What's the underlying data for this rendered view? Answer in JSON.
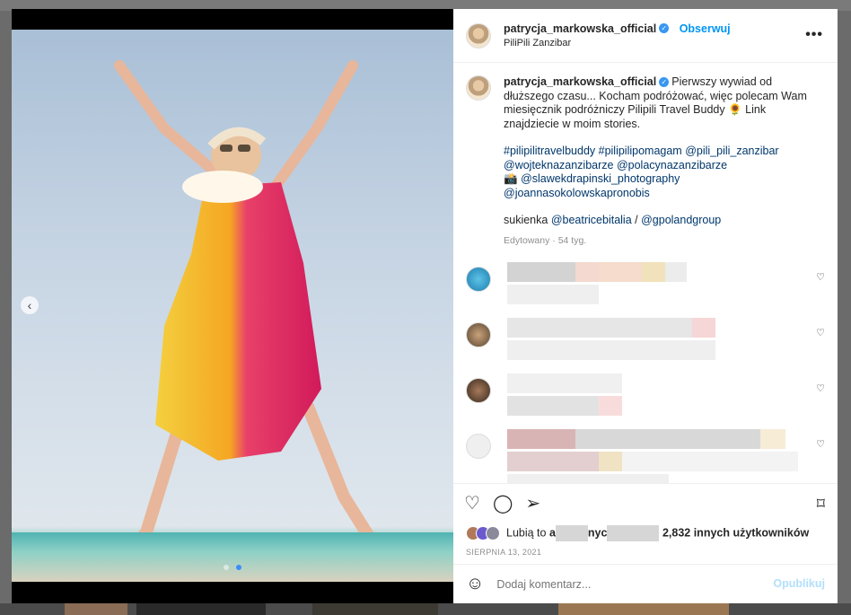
{
  "post": {
    "username": "patrycja_markowska_official",
    "verified_mark": "✓",
    "follow_label": "Obserwuj",
    "location": "PiliPili Zanzibar",
    "more_label": "•••"
  },
  "caption": {
    "text": "Pierwszy wywiad od dłuższego czasu... Kocham podróżować, więc polecam Wam miesięcznik podróżniczy Pilipili Travel Buddy 🌻 Link znajdziecie w moim stories.",
    "tags_line1": "#pilipilitravelbuddy #pilipilipomagam @pili_pili_zanzibar",
    "tags_line2": "@wojteknazanzibarze @polacynazanzibarze",
    "photo_credit_icon": "📸",
    "tags_line3": "@slawekdrapinski_photography",
    "tags_line4": "@joannasokolowskapronobis",
    "dress_label": "sukienka",
    "dress_tag1": "@beatricebitalia",
    "dress_sep": "/",
    "dress_tag2": "@gpolandgroup",
    "edited": "Edytowany · 54 tyg."
  },
  "icons": {
    "heart": "heart-icon",
    "comment": "comment-icon",
    "share": "share-icon",
    "bookmark": "bookmark-icon",
    "emoji": "emoji-icon",
    "prev": "chevron-left-icon",
    "more": "more-options-icon"
  },
  "glyphs": {
    "heart": "♡",
    "comment": "◯",
    "share": "➢",
    "bookmark": "⌑",
    "emoji": "☺",
    "prev": "‹"
  },
  "likes": {
    "prefix": "Lubią to",
    "initial": "a",
    "middle": "nyc",
    "suffix": "2,832 innych użytkowników"
  },
  "date": "SIERPNIA 13, 2021",
  "comment_box": {
    "placeholder": "Dodaj komentarz...",
    "publish_label": "Opublikuj"
  },
  "colors": {
    "link": "#00376b",
    "accent": "#0095f6",
    "publish_disabled": "#b2dffc"
  }
}
